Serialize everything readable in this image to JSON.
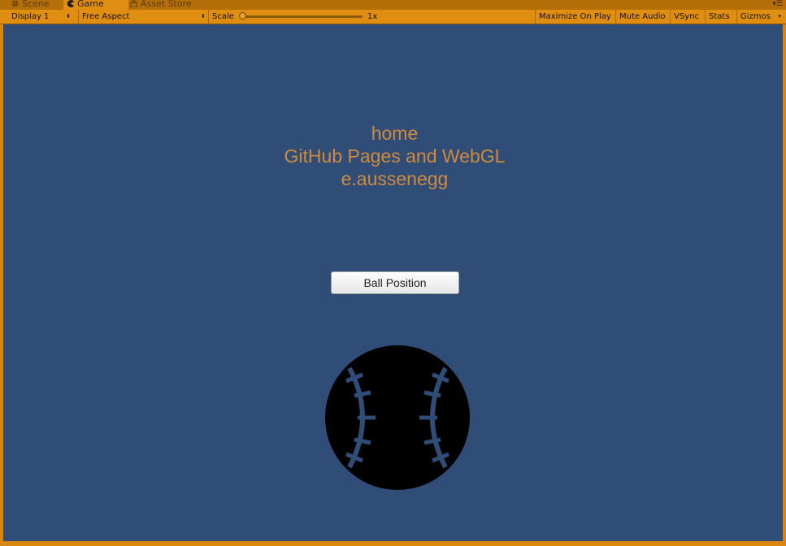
{
  "tabs": [
    {
      "label": "Scene",
      "icon": "grid-icon"
    },
    {
      "label": "Game",
      "icon": "pacman-icon",
      "active": true
    },
    {
      "label": "Asset Store",
      "icon": "store-icon"
    }
  ],
  "toolbar": {
    "display": "Display 1",
    "aspect": "Free Aspect",
    "scale_label": "Scale",
    "scale_value": "1x",
    "scale_fraction": 0.0,
    "maximize_on_play": "Maximize On Play",
    "mute_audio": "Mute Audio",
    "vsync": "VSync",
    "stats": "Stats",
    "gizmos": "Gizmos"
  },
  "game": {
    "lines": [
      "home",
      "GitHub Pages and WebGL",
      "e.aussenegg"
    ],
    "button_label": "Ball Position",
    "background_color": "#304d78",
    "text_color": "#d08a3c",
    "ball_color": "#000000"
  }
}
